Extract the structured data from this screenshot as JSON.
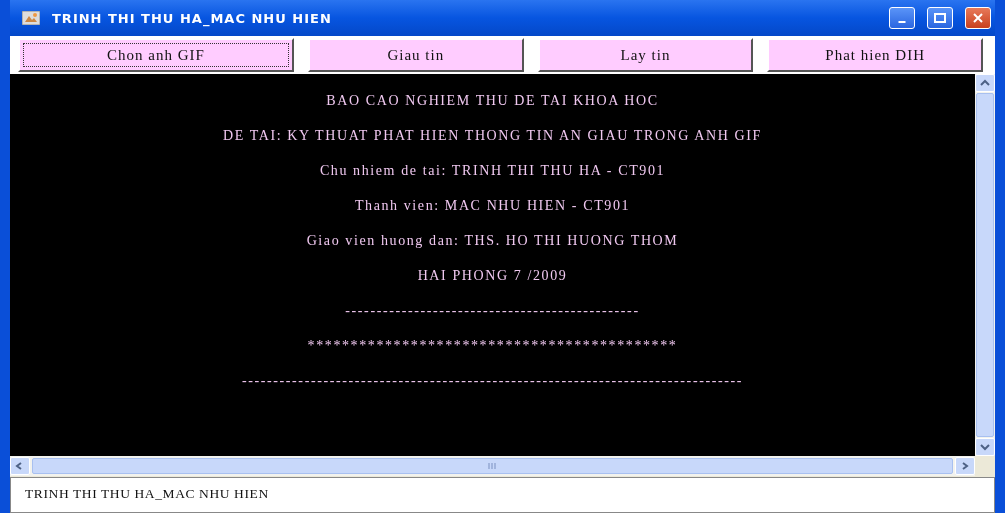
{
  "window": {
    "title": "TRINH THI THU HA_MAC NHU HIEN"
  },
  "toolbar": [
    {
      "label": "Chon anh GIF",
      "focused": true
    },
    {
      "label": "Giau tin",
      "focused": false
    },
    {
      "label": "Lay tin",
      "focused": false
    },
    {
      "label": "Phat hien DIH",
      "focused": false
    }
  ],
  "content": {
    "lines": [
      "BAO CAO NGHIEM THU DE TAI KHOA HOC",
      "DE TAI: KY THUAT PHAT HIEN THONG TIN AN GIAU TRONG ANH GIF",
      "Chu nhiem de tai: TRINH THI THU HA - CT901",
      "Thanh vien: MAC NHU HIEN - CT901",
      "Giao vien huong dan: THS. HO THI HUONG THOM",
      "HAI PHONG 7 /2009",
      "-----------------------------------------------",
      "*******************************************",
      "--------------------------------------------------------------------------------"
    ]
  },
  "status_field": {
    "value": "TRINH THI THU HA_MAC NHU HIEN"
  }
}
